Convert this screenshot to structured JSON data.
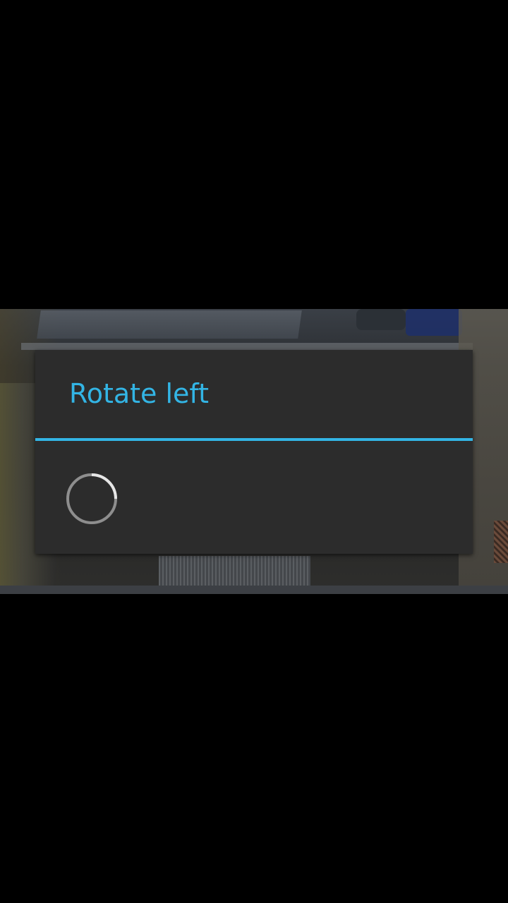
{
  "dialog": {
    "title": "Rotate left"
  },
  "progress": {
    "state": "indeterminate"
  },
  "colors": {
    "accent": "#33b5e5",
    "dialog_background": "#2c2c2c",
    "screen_background": "#000000"
  }
}
